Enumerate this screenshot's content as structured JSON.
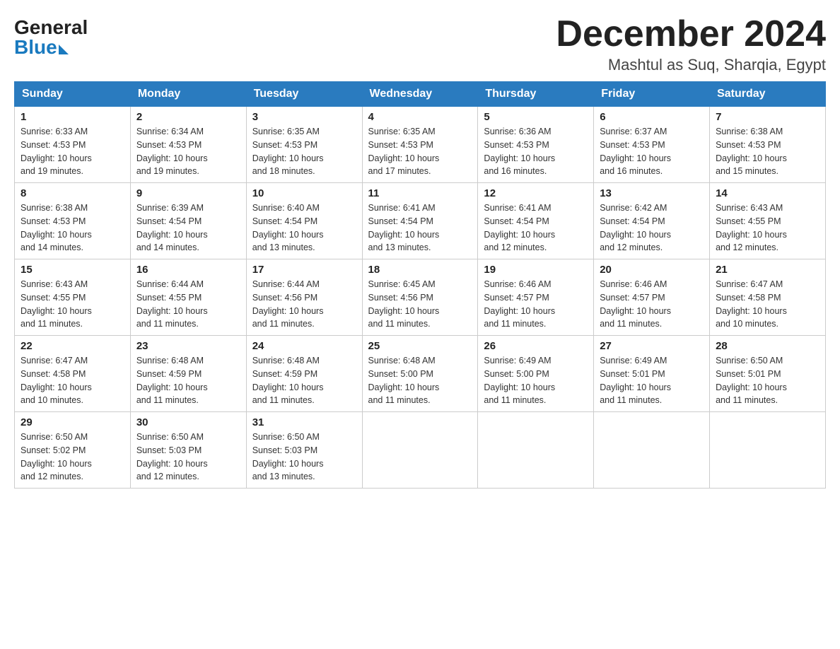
{
  "header": {
    "logo_general": "General",
    "logo_blue": "Blue",
    "month_title": "December 2024",
    "location": "Mashtul as Suq, Sharqia, Egypt"
  },
  "days_of_week": [
    "Sunday",
    "Monday",
    "Tuesday",
    "Wednesday",
    "Thursday",
    "Friday",
    "Saturday"
  ],
  "weeks": [
    [
      {
        "day": "1",
        "sunrise": "6:33 AM",
        "sunset": "4:53 PM",
        "daylight": "10 hours and 19 minutes."
      },
      {
        "day": "2",
        "sunrise": "6:34 AM",
        "sunset": "4:53 PM",
        "daylight": "10 hours and 19 minutes."
      },
      {
        "day": "3",
        "sunrise": "6:35 AM",
        "sunset": "4:53 PM",
        "daylight": "10 hours and 18 minutes."
      },
      {
        "day": "4",
        "sunrise": "6:35 AM",
        "sunset": "4:53 PM",
        "daylight": "10 hours and 17 minutes."
      },
      {
        "day": "5",
        "sunrise": "6:36 AM",
        "sunset": "4:53 PM",
        "daylight": "10 hours and 16 minutes."
      },
      {
        "day": "6",
        "sunrise": "6:37 AM",
        "sunset": "4:53 PM",
        "daylight": "10 hours and 16 minutes."
      },
      {
        "day": "7",
        "sunrise": "6:38 AM",
        "sunset": "4:53 PM",
        "daylight": "10 hours and 15 minutes."
      }
    ],
    [
      {
        "day": "8",
        "sunrise": "6:38 AM",
        "sunset": "4:53 PM",
        "daylight": "10 hours and 14 minutes."
      },
      {
        "day": "9",
        "sunrise": "6:39 AM",
        "sunset": "4:54 PM",
        "daylight": "10 hours and 14 minutes."
      },
      {
        "day": "10",
        "sunrise": "6:40 AM",
        "sunset": "4:54 PM",
        "daylight": "10 hours and 13 minutes."
      },
      {
        "day": "11",
        "sunrise": "6:41 AM",
        "sunset": "4:54 PM",
        "daylight": "10 hours and 13 minutes."
      },
      {
        "day": "12",
        "sunrise": "6:41 AM",
        "sunset": "4:54 PM",
        "daylight": "10 hours and 12 minutes."
      },
      {
        "day": "13",
        "sunrise": "6:42 AM",
        "sunset": "4:54 PM",
        "daylight": "10 hours and 12 minutes."
      },
      {
        "day": "14",
        "sunrise": "6:43 AM",
        "sunset": "4:55 PM",
        "daylight": "10 hours and 12 minutes."
      }
    ],
    [
      {
        "day": "15",
        "sunrise": "6:43 AM",
        "sunset": "4:55 PM",
        "daylight": "10 hours and 11 minutes."
      },
      {
        "day": "16",
        "sunrise": "6:44 AM",
        "sunset": "4:55 PM",
        "daylight": "10 hours and 11 minutes."
      },
      {
        "day": "17",
        "sunrise": "6:44 AM",
        "sunset": "4:56 PM",
        "daylight": "10 hours and 11 minutes."
      },
      {
        "day": "18",
        "sunrise": "6:45 AM",
        "sunset": "4:56 PM",
        "daylight": "10 hours and 11 minutes."
      },
      {
        "day": "19",
        "sunrise": "6:46 AM",
        "sunset": "4:57 PM",
        "daylight": "10 hours and 11 minutes."
      },
      {
        "day": "20",
        "sunrise": "6:46 AM",
        "sunset": "4:57 PM",
        "daylight": "10 hours and 11 minutes."
      },
      {
        "day": "21",
        "sunrise": "6:47 AM",
        "sunset": "4:58 PM",
        "daylight": "10 hours and 10 minutes."
      }
    ],
    [
      {
        "day": "22",
        "sunrise": "6:47 AM",
        "sunset": "4:58 PM",
        "daylight": "10 hours and 10 minutes."
      },
      {
        "day": "23",
        "sunrise": "6:48 AM",
        "sunset": "4:59 PM",
        "daylight": "10 hours and 11 minutes."
      },
      {
        "day": "24",
        "sunrise": "6:48 AM",
        "sunset": "4:59 PM",
        "daylight": "10 hours and 11 minutes."
      },
      {
        "day": "25",
        "sunrise": "6:48 AM",
        "sunset": "5:00 PM",
        "daylight": "10 hours and 11 minutes."
      },
      {
        "day": "26",
        "sunrise": "6:49 AM",
        "sunset": "5:00 PM",
        "daylight": "10 hours and 11 minutes."
      },
      {
        "day": "27",
        "sunrise": "6:49 AM",
        "sunset": "5:01 PM",
        "daylight": "10 hours and 11 minutes."
      },
      {
        "day": "28",
        "sunrise": "6:50 AM",
        "sunset": "5:01 PM",
        "daylight": "10 hours and 11 minutes."
      }
    ],
    [
      {
        "day": "29",
        "sunrise": "6:50 AM",
        "sunset": "5:02 PM",
        "daylight": "10 hours and 12 minutes."
      },
      {
        "day": "30",
        "sunrise": "6:50 AM",
        "sunset": "5:03 PM",
        "daylight": "10 hours and 12 minutes."
      },
      {
        "day": "31",
        "sunrise": "6:50 AM",
        "sunset": "5:03 PM",
        "daylight": "10 hours and 13 minutes."
      },
      null,
      null,
      null,
      null
    ]
  ],
  "labels": {
    "sunrise": "Sunrise:",
    "sunset": "Sunset:",
    "daylight": "Daylight:"
  }
}
